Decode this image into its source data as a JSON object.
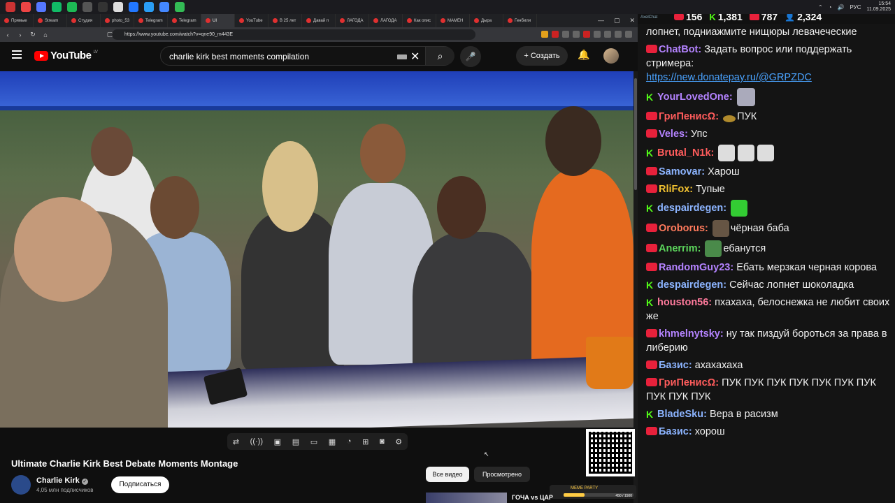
{
  "taskbar": {
    "time": "15:54",
    "date": "11.09.2025",
    "lang": "РУС"
  },
  "browser": {
    "tabs": [
      "Прямые",
      "Stream",
      "Студия",
      "photo_53",
      "Telegram",
      "Telegram",
      "UI",
      "YouTube",
      "В 25 лет",
      "Давай п",
      "ЛАГОДА",
      "ЛАГОДА",
      "Как опис",
      "МАМЕН",
      "Дыра",
      "Генбили"
    ],
    "url": "https://www.youtube.com/watch?v=qne90_m443E"
  },
  "youtube": {
    "logo_text": "YouTube",
    "country": "LV",
    "search_query": "charlie kirk best moments compilation",
    "create_label": "Создать",
    "video_title": "Ultimate Charlie Kirk Best Debate Moments Montage",
    "channel_name": "Charlie Kirk",
    "subscribers": "4,05 млн подписчиков",
    "subscribe_label": "Подписаться",
    "chips": [
      "Все видео",
      "Просмотрено"
    ],
    "recommended_title": "ГОЧА vs ЦАР",
    "meme_badge": "MEME PARTY",
    "meme_count": "450 / 1500",
    "meme_progress": 0.3
  },
  "chat": {
    "brand": "AxelChat",
    "stats": {
      "youtube": "156",
      "kick": "1,381",
      "live": "787",
      "viewers": "2,324"
    },
    "messages": [
      {
        "platform": "live",
        "nick": "",
        "color": "#ffffff",
        "text": "лопнет, подниажмите нищюры левачеческие"
      },
      {
        "platform": "live",
        "nick": "ChatBot:",
        "color": "#b483ff",
        "text": "Задать вопрос или поддержать стримера:",
        "link": "https://new.donatepay.ru/@GRPZDC"
      },
      {
        "platform": "kick",
        "nick": "YourLovedOne:",
        "color": "#b483ff",
        "text": ""
      },
      {
        "platform": "live",
        "nick": "ГриПенисΩ:",
        "color": "#ff5c5c",
        "text": "ПУК"
      },
      {
        "platform": "live",
        "nick": "Veles:",
        "color": "#b483ff",
        "text": "Упс"
      },
      {
        "platform": "kick",
        "nick": "Brutal_N1k:",
        "color": "#ff5c5c",
        "text": ""
      },
      {
        "platform": "live",
        "nick": "Samovar:",
        "color": "#8cb4ff",
        "text": "Харош"
      },
      {
        "platform": "live",
        "nick": "RliFox:",
        "color": "#f0c030",
        "text": "Тупые"
      },
      {
        "platform": "kick",
        "nick": "despairdegen:",
        "color": "#8cb4ff",
        "text": ""
      },
      {
        "platform": "live",
        "nick": "Oroborus:",
        "color": "#ff7a5c",
        "text": "чёрная баба"
      },
      {
        "platform": "live",
        "nick": "Anerrim:",
        "color": "#5cd65c",
        "text": "ебанутся"
      },
      {
        "platform": "live",
        "nick": "RandomGuy23:",
        "color": "#b483ff",
        "text": "Ебать мерзкая черная корова"
      },
      {
        "platform": "kick",
        "nick": "despairdegen:",
        "color": "#8cb4ff",
        "text": "Сейчас лопнет шоколадка"
      },
      {
        "platform": "kick",
        "nick": "houston56:",
        "color": "#ff7a9c",
        "text": "пхахаха, белоснежка не любит своих же"
      },
      {
        "platform": "live",
        "nick": "khmelnytsky:",
        "color": "#b483ff",
        "text": "ну так пиздуй бороться за права в либерию"
      },
      {
        "platform": "live",
        "nick": "Базис:",
        "color": "#8cb4ff",
        "text": "ахахахаха"
      },
      {
        "platform": "live",
        "nick": "ГриПенисΩ:",
        "color": "#ff5c5c",
        "text": "ПУК ПУК ПУК ПУК ПУК ПУК ПУК ПУК ПУК ПУК"
      },
      {
        "platform": "kick",
        "nick": "BladeSku:",
        "color": "#8cb4ff",
        "text": "Вера в расизм"
      },
      {
        "platform": "live",
        "nick": "Базис:",
        "color": "#8cb4ff",
        "text": "хорош"
      }
    ]
  }
}
